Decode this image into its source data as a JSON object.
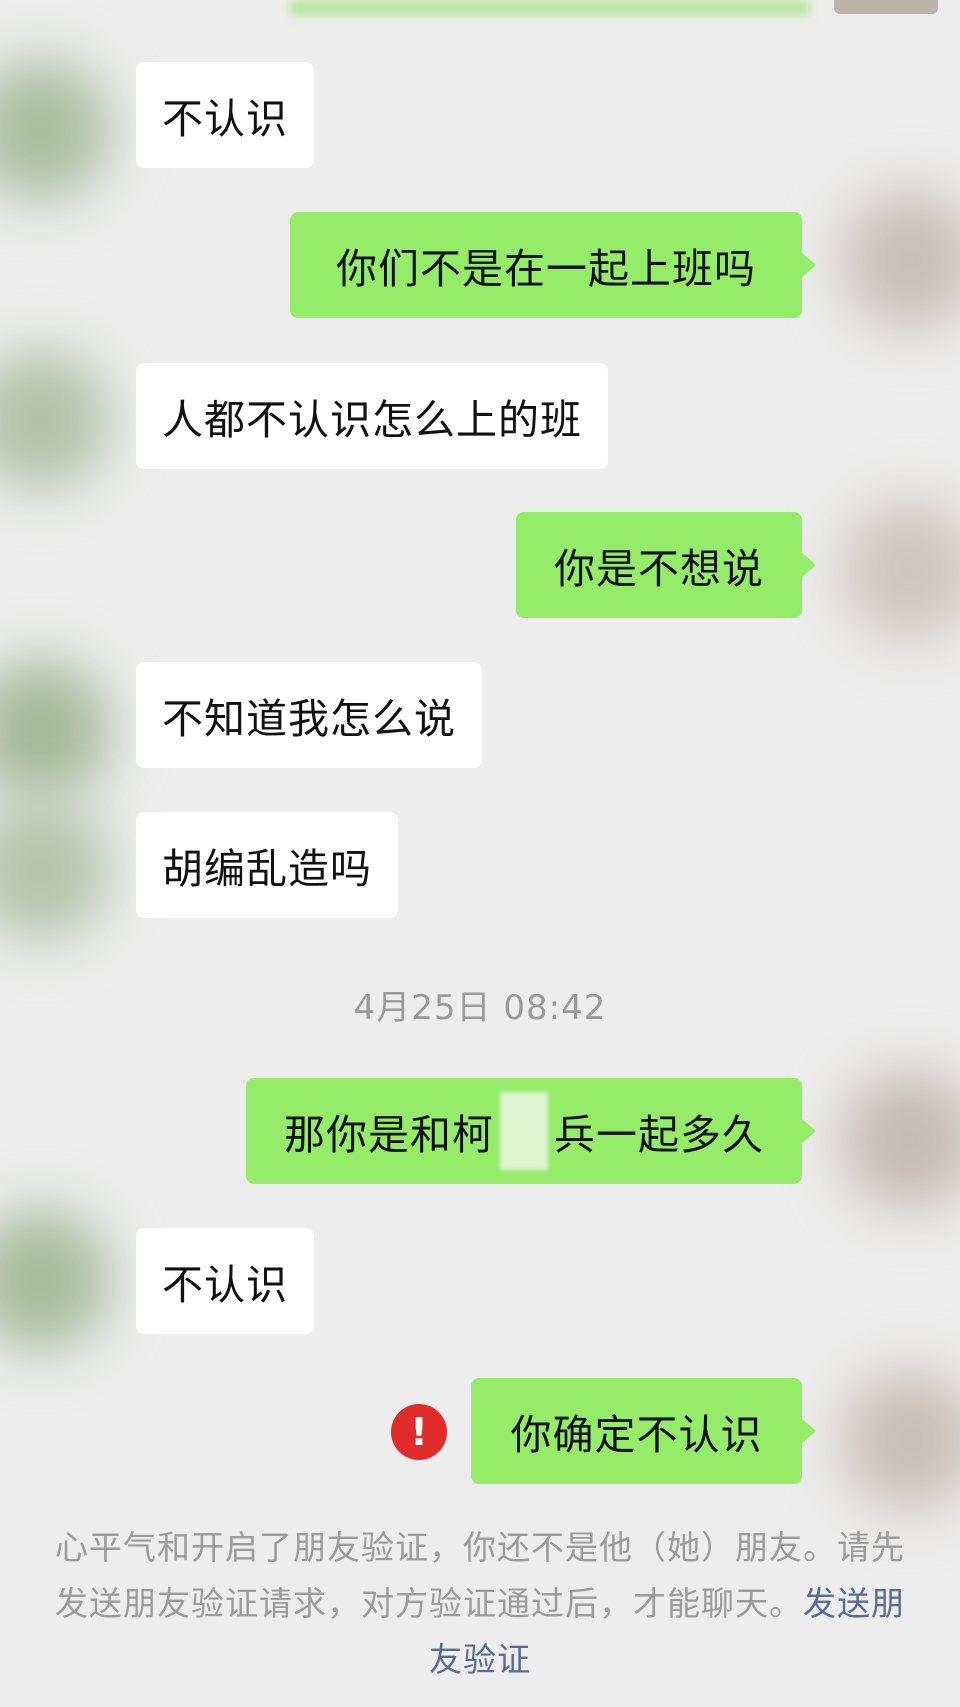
{
  "messages": [
    {
      "side": "left",
      "text": "不认识"
    },
    {
      "side": "right",
      "text": "你们不是在一起上班吗"
    },
    {
      "side": "left",
      "text": "人都不认识怎么上的班"
    },
    {
      "side": "right",
      "text": "你是不想说"
    },
    {
      "side": "left",
      "text": "不知道我怎么说"
    },
    {
      "side": "left",
      "text": "胡编乱造吗"
    },
    {
      "side": "right",
      "text_before_mask": "那你是和柯",
      "text_after_mask": "兵一起多久"
    },
    {
      "side": "left",
      "text": "不认识"
    },
    {
      "side": "right",
      "text": "你确定不认识",
      "status": "send-failed"
    }
  ],
  "timestamp": "4月25日 08:42",
  "error_icon_symbol": "!",
  "notice": {
    "text": "心平气和开启了朋友验证，你还不是他（她）朋友。请先发送朋友验证请求，对方验证通过后，才能聊天。",
    "link": "发送朋友验证"
  },
  "colors": {
    "background": "#ededed",
    "outgoing_bubble": "#95ec69",
    "incoming_bubble": "#ffffff",
    "error": "#e22b2b",
    "link": "#576b95"
  }
}
